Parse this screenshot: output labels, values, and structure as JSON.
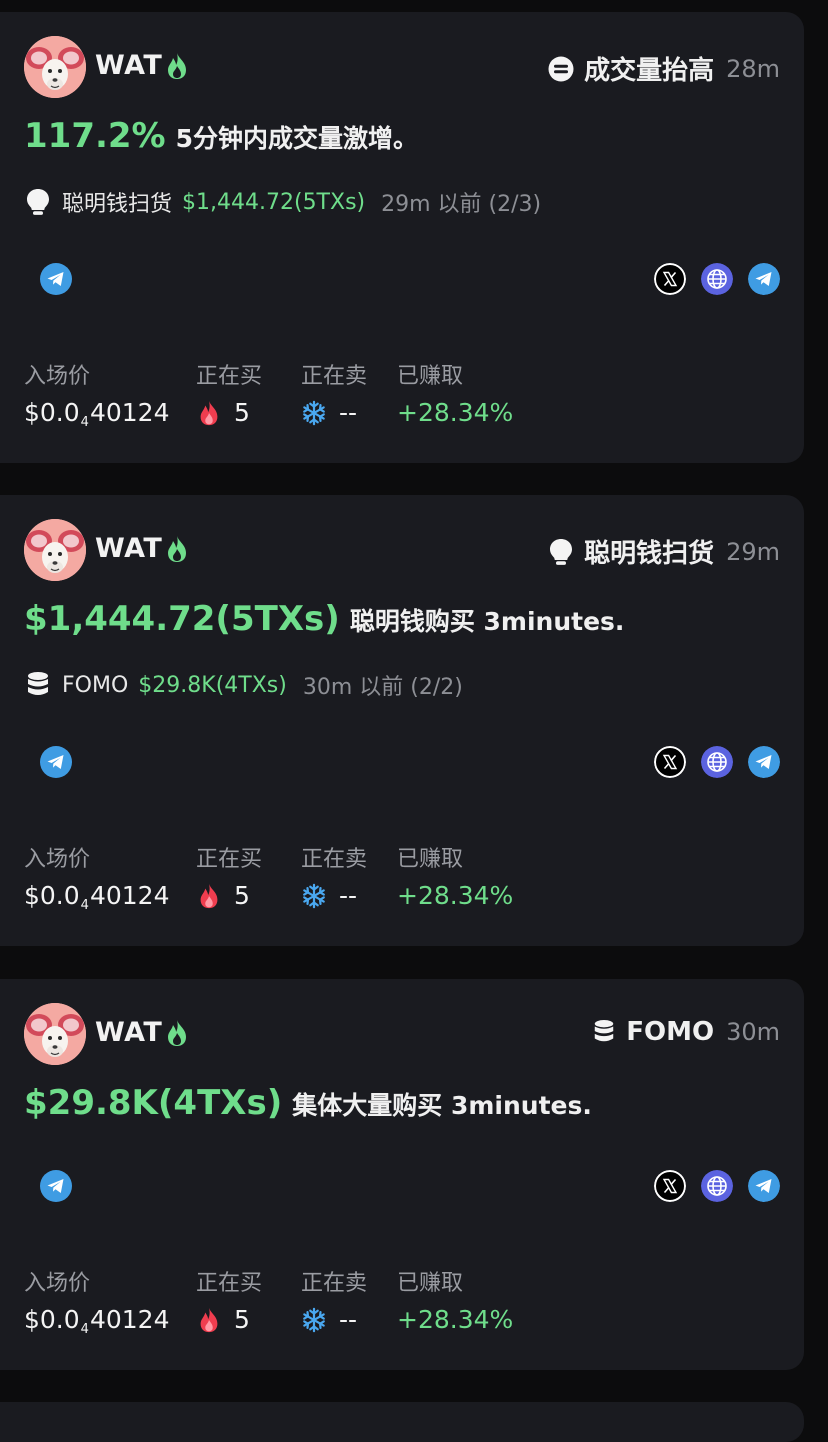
{
  "cards": [
    {
      "ticker": "WAT",
      "tag_label": "成交量抬高",
      "tag_time": "28m",
      "headline_big": "117.2%",
      "headline_rest": "5分钟内成交量激增。",
      "sub_label": "聪明钱扫货",
      "sub_amount": "$1,444.72(5TXs)",
      "sub_time": "29m 以前 (2/3)",
      "stats": {
        "entry_label": "入场价",
        "entry_prefix": "$0.0",
        "entry_sub": "4",
        "entry_suffix": "40124",
        "buying_label": "正在买",
        "buying_value": "5",
        "selling_label": "正在卖",
        "selling_value": "--",
        "earned_label": "已赚取",
        "earned_value": "+28.34%"
      }
    },
    {
      "ticker": "WAT",
      "tag_label": "聪明钱扫货",
      "tag_time": "29m",
      "headline_big": "$1,444.72(5TXs)",
      "headline_rest": "聪明钱购买 3minutes.",
      "sub_label": "FOMO",
      "sub_amount": "$29.8K(4TXs)",
      "sub_time": "30m 以前 (2/2)",
      "stats": {
        "entry_label": "入场价",
        "entry_prefix": "$0.0",
        "entry_sub": "4",
        "entry_suffix": "40124",
        "buying_label": "正在买",
        "buying_value": "5",
        "selling_label": "正在卖",
        "selling_value": "--",
        "earned_label": "已赚取",
        "earned_value": "+28.34%"
      }
    },
    {
      "ticker": "WAT",
      "tag_label": "FOMO",
      "tag_time": "30m",
      "headline_big": "$29.8K(4TXs)",
      "headline_rest": "集体大量购买 3minutes.",
      "stats": {
        "entry_label": "入场价",
        "entry_prefix": "$0.0",
        "entry_sub": "4",
        "entry_suffix": "40124",
        "buying_label": "正在买",
        "buying_value": "5",
        "selling_label": "正在卖",
        "selling_value": "--",
        "earned_label": "已赚取",
        "earned_value": "+28.34%"
      }
    }
  ],
  "colors": {
    "accent_green": "#6fdd8b",
    "card_bg": "#1a1b20",
    "telegram": "#3f9ce3",
    "globe": "#5b63e0"
  },
  "icons": [
    "volume-up-icon",
    "lightbulb-icon",
    "database-icon",
    "flame-icon",
    "snowflake-icon",
    "telegram-icon",
    "x-logo-icon",
    "globe-icon"
  ]
}
